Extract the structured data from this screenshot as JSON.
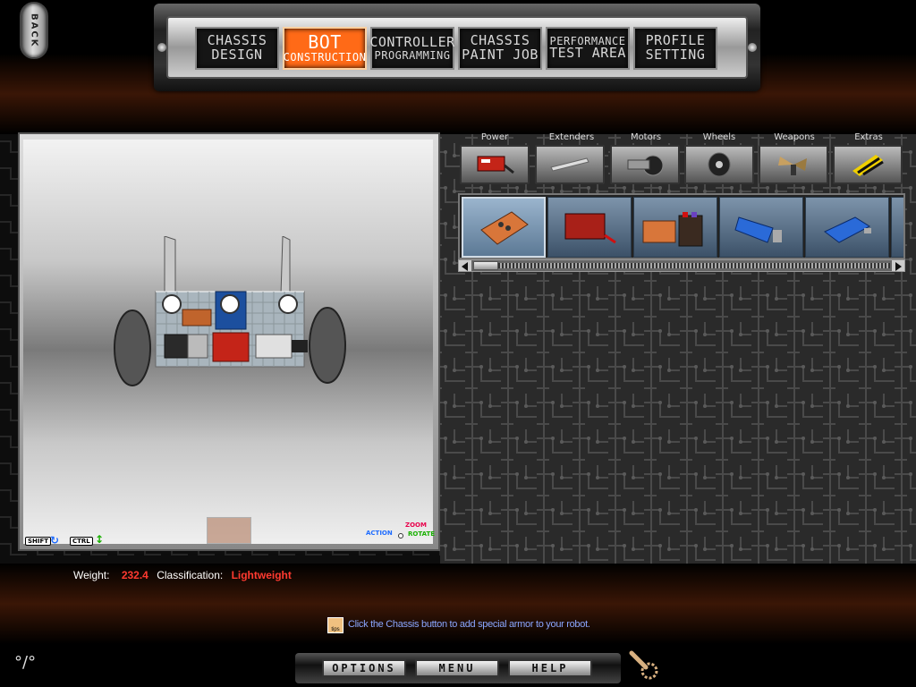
{
  "back_label": "BACK",
  "nav": {
    "tabs": [
      {
        "line1": "CHASSIS",
        "line2": "DESIGN",
        "active": false
      },
      {
        "line1": "BOT",
        "line2": "CONSTRUCTION",
        "active": true
      },
      {
        "line1": "CONTROLLER",
        "line2": "PROGRAMMING",
        "active": false
      },
      {
        "line1": "CHASSIS",
        "line2": "PAINT JOB",
        "active": false
      },
      {
        "line1": "PERFORMANCE",
        "line2": "TEST AREA",
        "active": false
      },
      {
        "line1": "PROFILE",
        "line2": "SETTING",
        "active": false
      }
    ]
  },
  "viewport": {
    "hints": {
      "shift": "SHIFT",
      "ctrl": "CTRL",
      "zoom": "ZOOM",
      "action": "ACTION",
      "rotate": "ROTATE"
    }
  },
  "categories": [
    "Power",
    "Extenders",
    "Motors",
    "Wheels",
    "Weapons",
    "Extras"
  ],
  "parts": {
    "selected_index": 0,
    "count_visible": 5,
    "scroll_position": 0.0
  },
  "status": {
    "weight_label": "Weight:",
    "weight_value": "232.4",
    "classification_label": "Classification:",
    "classification_value": "Lightweight"
  },
  "tip": {
    "icon_text": "tips",
    "text": "Click the Chassis button to add special armor to your robot."
  },
  "bottom": {
    "options": "OPTIONS",
    "menu": "MENU",
    "help": "HELP"
  },
  "logo": "°/°",
  "colors": {
    "accent_orange": "#ff6a17",
    "value_red": "#ff3a30",
    "tip_blue": "#8aa6ff"
  }
}
